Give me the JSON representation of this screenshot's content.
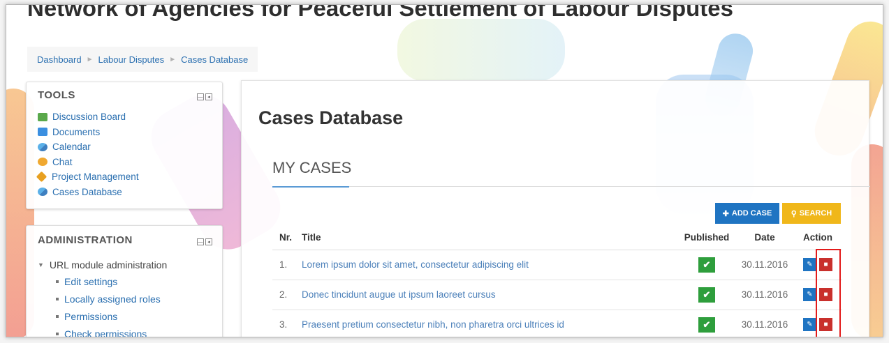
{
  "site": {
    "title": "Network of Agencies for Peaceful Settlement of Labour Disputes"
  },
  "breadcrumb": [
    "Dashboard",
    "Labour Disputes",
    "Cases Database"
  ],
  "tools_block": {
    "title": "TOOLS",
    "items": [
      {
        "label": "Discussion Board",
        "icon": "discussion-icon"
      },
      {
        "label": "Documents",
        "icon": "folder-icon"
      },
      {
        "label": "Calendar",
        "icon": "calendar-icon"
      },
      {
        "label": "Chat",
        "icon": "chat-icon"
      },
      {
        "label": "Project Management",
        "icon": "project-icon"
      },
      {
        "label": "Cases Database",
        "icon": "database-icon"
      }
    ]
  },
  "admin_block": {
    "title": "ADMINISTRATION",
    "parent": "URL module administration",
    "items": [
      "Edit settings",
      "Locally assigned roles",
      "Permissions",
      "Check permissions"
    ]
  },
  "main": {
    "page_title": "Cases Database",
    "section_title": "MY CASES",
    "add_button": "ADD CASE",
    "search_button": "SEARCH",
    "columns": {
      "nr": "Nr.",
      "title": "Title",
      "published": "Published",
      "date": "Date",
      "action": "Action"
    },
    "rows": [
      {
        "nr": "1.",
        "title": "Lorem ipsum dolor sit amet, consectetur adipiscing elit",
        "published": true,
        "date": "30.11.2016"
      },
      {
        "nr": "2.",
        "title": "Donec tincidunt augue ut ipsum laoreet cursus",
        "published": true,
        "date": "30.11.2016"
      },
      {
        "nr": "3.",
        "title": "Praesent pretium consectetur nibh, non pharetra orci ultrices id",
        "published": true,
        "date": "30.11.2016"
      }
    ]
  },
  "colors": {
    "link": "#2a6fb0",
    "add_button": "#1f74c2",
    "search_button": "#f0b71a",
    "published": "#2e9e3c",
    "delete": "#c9302c",
    "highlight": "#e31b1b"
  }
}
